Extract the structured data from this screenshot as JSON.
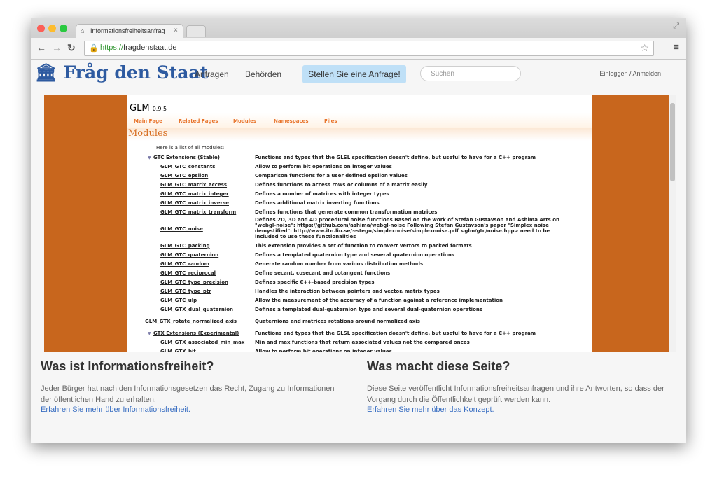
{
  "browser": {
    "tab_title": "Informationsfreiheitsanfrag",
    "tab_close": "×",
    "url_scheme": "https://",
    "url_host": "fragdenstaat.de"
  },
  "site": {
    "logo": "Fråg den Staat",
    "nav": [
      "Anfragen",
      "Behörden"
    ],
    "cta": "Stellen Sie eine Anfrage!",
    "search_placeholder": "Suchen",
    "login": "Einloggen / Anmelden"
  },
  "doc": {
    "project": "GLM",
    "version": "0.9.5",
    "tabs": [
      "Main Page",
      "Related Pages",
      "Modules",
      "Namespaces",
      "Files"
    ],
    "heading": "Modules",
    "intro": "Here is a list of all modules:",
    "rows": [
      {
        "name": "GTC Extensions (Stable)",
        "desc": "Functions and types that the GLSL specification doesn't define, but useful to have for a C++ program"
      },
      {
        "name": "GLM_GTC_constants",
        "desc": "Allow to perform bit operations on integer values"
      },
      {
        "name": "GLM_GTC_epsilon",
        "desc": "Comparison functions for a user defined epsilon values"
      },
      {
        "name": "GLM_GTC_matrix_access",
        "desc": "Defines functions to access rows or columns of a matrix easily"
      },
      {
        "name": "GLM_GTC_matrix_integer",
        "desc": "Defines a number of matrices with integer types"
      },
      {
        "name": "GLM_GTC_matrix_inverse",
        "desc": "Defines additional matrix inverting functions"
      },
      {
        "name": "GLM_GTC_matrix_transform",
        "desc": "Defines functions that generate common transformation matrices"
      },
      {
        "name": "GLM_GTC_noise",
        "desc": "Defines 2D, 3D and 4D procedural noise functions Based on the work of Stefan Gustavson and Ashima Arts on \"webgl-noise\": https://github.com/ashima/webgl-noise Following Stefan Gustavson's paper \"Simplex noise demystified\": http://www.itn.liu.se/~stegu/simplexnoise/simplexnoise.pdf <glm/gtc/noise.hpp> need to be included to use these functionalities"
      },
      {
        "name": "GLM_GTC_packing",
        "desc": "This extension provides a set of function to convert vertors to packed formats"
      },
      {
        "name": "GLM_GTC_quaternion",
        "desc": "Defines a templated quaternion type and several quaternion operations"
      },
      {
        "name": "GLM_GTC_random",
        "desc": "Generate random number from various distribution methods"
      },
      {
        "name": "GLM_GTC_reciprocal",
        "desc": "Define secant, cosecant and cotangent functions"
      },
      {
        "name": "GLM_GTC_type_precision",
        "desc": "Defines specific C++-based precision types"
      },
      {
        "name": "GLM_GTC_type_ptr",
        "desc": "Handles the interaction between pointers and vector, matrix types"
      },
      {
        "name": "GLM_GTC_ulp",
        "desc": "Allow the measurement of the accuracy of a function against a reference implementation"
      },
      {
        "name": "GLM_GTX_dual_quaternion",
        "desc": "Defines a templated dual-quaternion type and several dual-quaternion operations"
      },
      {
        "name": "GLM_GTX_rotate_normalized_axis",
        "desc": "Quaternions and matrices rotations around normalized axis"
      },
      {
        "name": "GTX Extensions (Experimental)",
        "desc": "Functions and types that the GLSL specification doesn't define, but useful to have for a C++ program"
      },
      {
        "name": "GLM_GTX_associated_min_max",
        "desc": "Min and max functions that return associated values not the compared onces"
      },
      {
        "name": "GLM_GTX_bit",
        "desc": "Allow to perform bit operations on integer values"
      }
    ]
  },
  "footer": {
    "left_heading": "Was ist Informationsfreiheit?",
    "left_text": "Jeder Bürger hat nach den Informationsgesetzen das Recht, Zugang zu Informationen der öffentlichen Hand zu erhalten.",
    "left_link": "Erfahren Sie mehr über Informationsfreiheit.",
    "right_heading": "Was macht diese Seite?",
    "right_text": "Diese Seite veröffentlicht Informationsfreiheitsanfragen und ihre Antworten, so dass der Vorgang durch die Öffentlichkeit geprüft werden kann.",
    "right_link": "Erfahren Sie mehr über das Konzept."
  },
  "colors": {
    "brand_blue": "#2d5aa0",
    "doxygen_orange": "#c8661d",
    "cta_bg": "#bfe0f7",
    "link_blue": "#3a6fc2"
  }
}
